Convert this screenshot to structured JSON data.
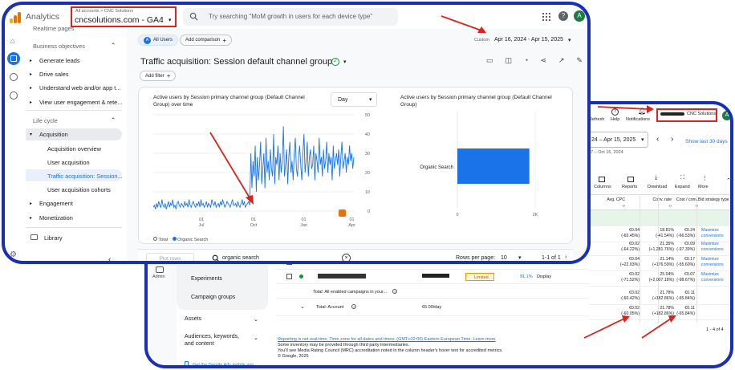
{
  "ga": {
    "app_title": "Analytics",
    "breadcrumb": "All accounts > CNC Solutions",
    "property": "cncsolutions.com - GA4",
    "search_placeholder": "Try searching \"MoM growth in users for each device type\"",
    "avatar_letter": "A",
    "nav": {
      "top_cut": "Realtime pages",
      "business_objectives": "Business objectives",
      "items": [
        "Generate leads",
        "Drive sales",
        "Understand web and/or app t...",
        "View user engagement & rete..."
      ],
      "life_cycle": "Life cycle",
      "acquisition": "Acquisition",
      "acq_items": [
        "Acquisition overview",
        "User acquisition",
        "Traffic acquisition: Session...",
        "User acquisition cohorts"
      ],
      "engagement": "Engagement",
      "monetization": "Monetization",
      "library": "Library"
    },
    "all_users": "All Users",
    "add_comparison": "Add comparison",
    "date_label": "Custom",
    "date_range": "Apr 16, 2024 - Apr 15, 2025",
    "report_title": "Traffic acquisition: Session default channel group",
    "add_filter": "Add filter",
    "line_chart_title": "Active users by Session primary channel group (Default Channel Group) over time",
    "granularity": "Day",
    "bar_chart_title": "Active users by Session primary channel group (Default Channel Group)",
    "legend": [
      "Total",
      "Organic Search"
    ],
    "plot_rows": "Plot rows",
    "table_search": "organic search",
    "rows_per_page_label": "Rows per page:",
    "rows_per_page": "10",
    "pagination": "1-1 of 1",
    "colors": {
      "accent": "#1a73e8",
      "bar": "#1a73e8",
      "highlight": "#e8f0fe"
    }
  },
  "chart_data": [
    {
      "type": "line",
      "title": "Active users by Session primary channel group (Default Channel Group) over time",
      "x_ticks": [
        "01\nJul",
        "01\nOct",
        "01\nJan",
        "01\nApr"
      ],
      "y_ticks": [
        "0",
        "10",
        "20",
        "30",
        "40",
        "50"
      ],
      "ylim": [
        0,
        50
      ],
      "legend_position": "bottom-left",
      "series": [
        {
          "name": "Organic Search",
          "values": [
            2,
            3,
            1,
            4,
            2,
            5,
            3,
            2,
            6,
            3,
            2,
            4,
            1,
            3,
            5,
            2,
            4,
            3,
            6,
            2,
            3,
            1,
            4,
            5,
            3,
            2,
            4,
            3,
            2,
            5,
            3,
            4,
            2,
            6,
            3,
            2,
            4,
            5,
            3,
            2,
            4,
            3,
            5,
            2,
            6,
            3,
            4,
            2,
            3,
            5,
            2,
            4,
            3,
            2,
            6,
            4,
            3,
            5,
            2,
            3,
            4,
            2,
            5,
            3,
            6,
            4,
            2,
            3,
            5,
            4,
            3,
            2,
            4,
            6,
            3,
            3,
            4,
            2,
            5,
            3,
            2,
            4,
            6,
            3,
            5,
            2,
            3,
            4,
            5,
            3,
            30,
            12,
            26,
            18,
            34,
            10,
            28,
            16,
            24,
            36,
            14,
            22,
            30,
            12,
            38,
            20,
            26,
            16,
            32,
            22,
            18,
            40,
            14,
            28,
            24,
            34,
            16,
            30,
            20,
            26,
            44,
            18,
            24,
            32,
            14,
            28,
            36,
            20,
            26,
            16,
            30,
            38,
            22,
            18,
            28,
            34,
            24,
            16,
            30,
            40,
            20,
            26,
            36,
            18,
            28,
            32,
            22,
            24,
            34,
            16,
            30,
            26,
            20,
            38,
            24,
            28,
            18,
            32,
            22,
            26,
            36,
            20,
            30,
            24,
            28,
            16,
            34,
            22,
            26,
            30,
            24,
            32,
            18,
            28,
            36,
            22,
            26,
            30,
            20,
            28,
            24,
            34,
            26,
            30,
            22,
            28
          ]
        }
      ]
    },
    {
      "type": "bar",
      "title": "Active users by Session primary channel group (Default Channel Group)",
      "categories": [
        "Organic Search"
      ],
      "values": [
        1850
      ],
      "x_ticks": [
        "0",
        "2K"
      ],
      "xlim": [
        0,
        2000
      ]
    }
  ],
  "ads": {
    "toolbar": [
      "Refresh",
      "Help",
      "Notifications"
    ],
    "account_name": "CNC Solutions",
    "avatar_letter": "A",
    "date_range": "24 – Apr 15, 2025",
    "date_sub": "17 – Oct 15, 2024",
    "show_last": "Show last 30 days",
    "tools": [
      "Columns",
      "Reports",
      "Download",
      "Expand",
      "More"
    ],
    "headers": [
      "Avg. CPC",
      "Conv. rate",
      "Cost / conv.",
      "Bid strategy type"
    ],
    "rows": [
      [
        "€0.04",
        "(-65.45%)",
        "18.81%",
        "(-41.54%)",
        "€0.24",
        "(-66.53%)",
        "Maximize",
        "conversions"
      ],
      [
        "€0.02",
        "(-64.22%)",
        "21.35%",
        "(+1,281.76%)",
        "€0.09",
        "(-97.39%)",
        "Maximize",
        "conversions"
      ],
      [
        "€0.04",
        "(+22.03%)",
        "21.14%",
        "(+176.59%)",
        "€0.17",
        "(-55.60%)",
        "Maximize",
        "conversions"
      ],
      [
        "€0.02",
        "(-71.52%)",
        "25.04%",
        "(+2,007.18%)",
        "€0.07",
        "(-98.67%)",
        "Maximize",
        "conversions"
      ],
      [
        "€0.02",
        "(-60.42%)",
        "21.78%",
        "(+182.86%)",
        "€0.11",
        "(-65.84%)",
        "",
        ""
      ],
      [
        "€0.02",
        "(-60.05%)",
        "21.78%",
        "(+182.86%)",
        "€0.11",
        "(-65.84%)",
        "",
        ""
      ]
    ],
    "side": [
      "Admin"
    ],
    "menu": [
      "Experiments",
      "Campaign groups",
      "Assets",
      "Audiences, keywords, and content"
    ],
    "campaign_type": "Display",
    "status": "Limited",
    "row_pct": "91.1%",
    "total_row1": "Total: All enabled campaigns in your...",
    "total_row2": "Total: Account",
    "budget": "€6.00/day",
    "pager": "1 - 4 of 4",
    "footer": [
      "Reporting is not real-time. Time zone for all dates and times: (GMT+02:00) Eastern European Time. Learn more",
      "Some inventory may be provided through third party intermediaries.",
      "You'll see Media Rating Council (MRC) accreditation noted in the column header's hover text for accredited metrics.",
      "© Google, 2025"
    ],
    "mobile_app": "Get the Google Ads mobile app"
  }
}
